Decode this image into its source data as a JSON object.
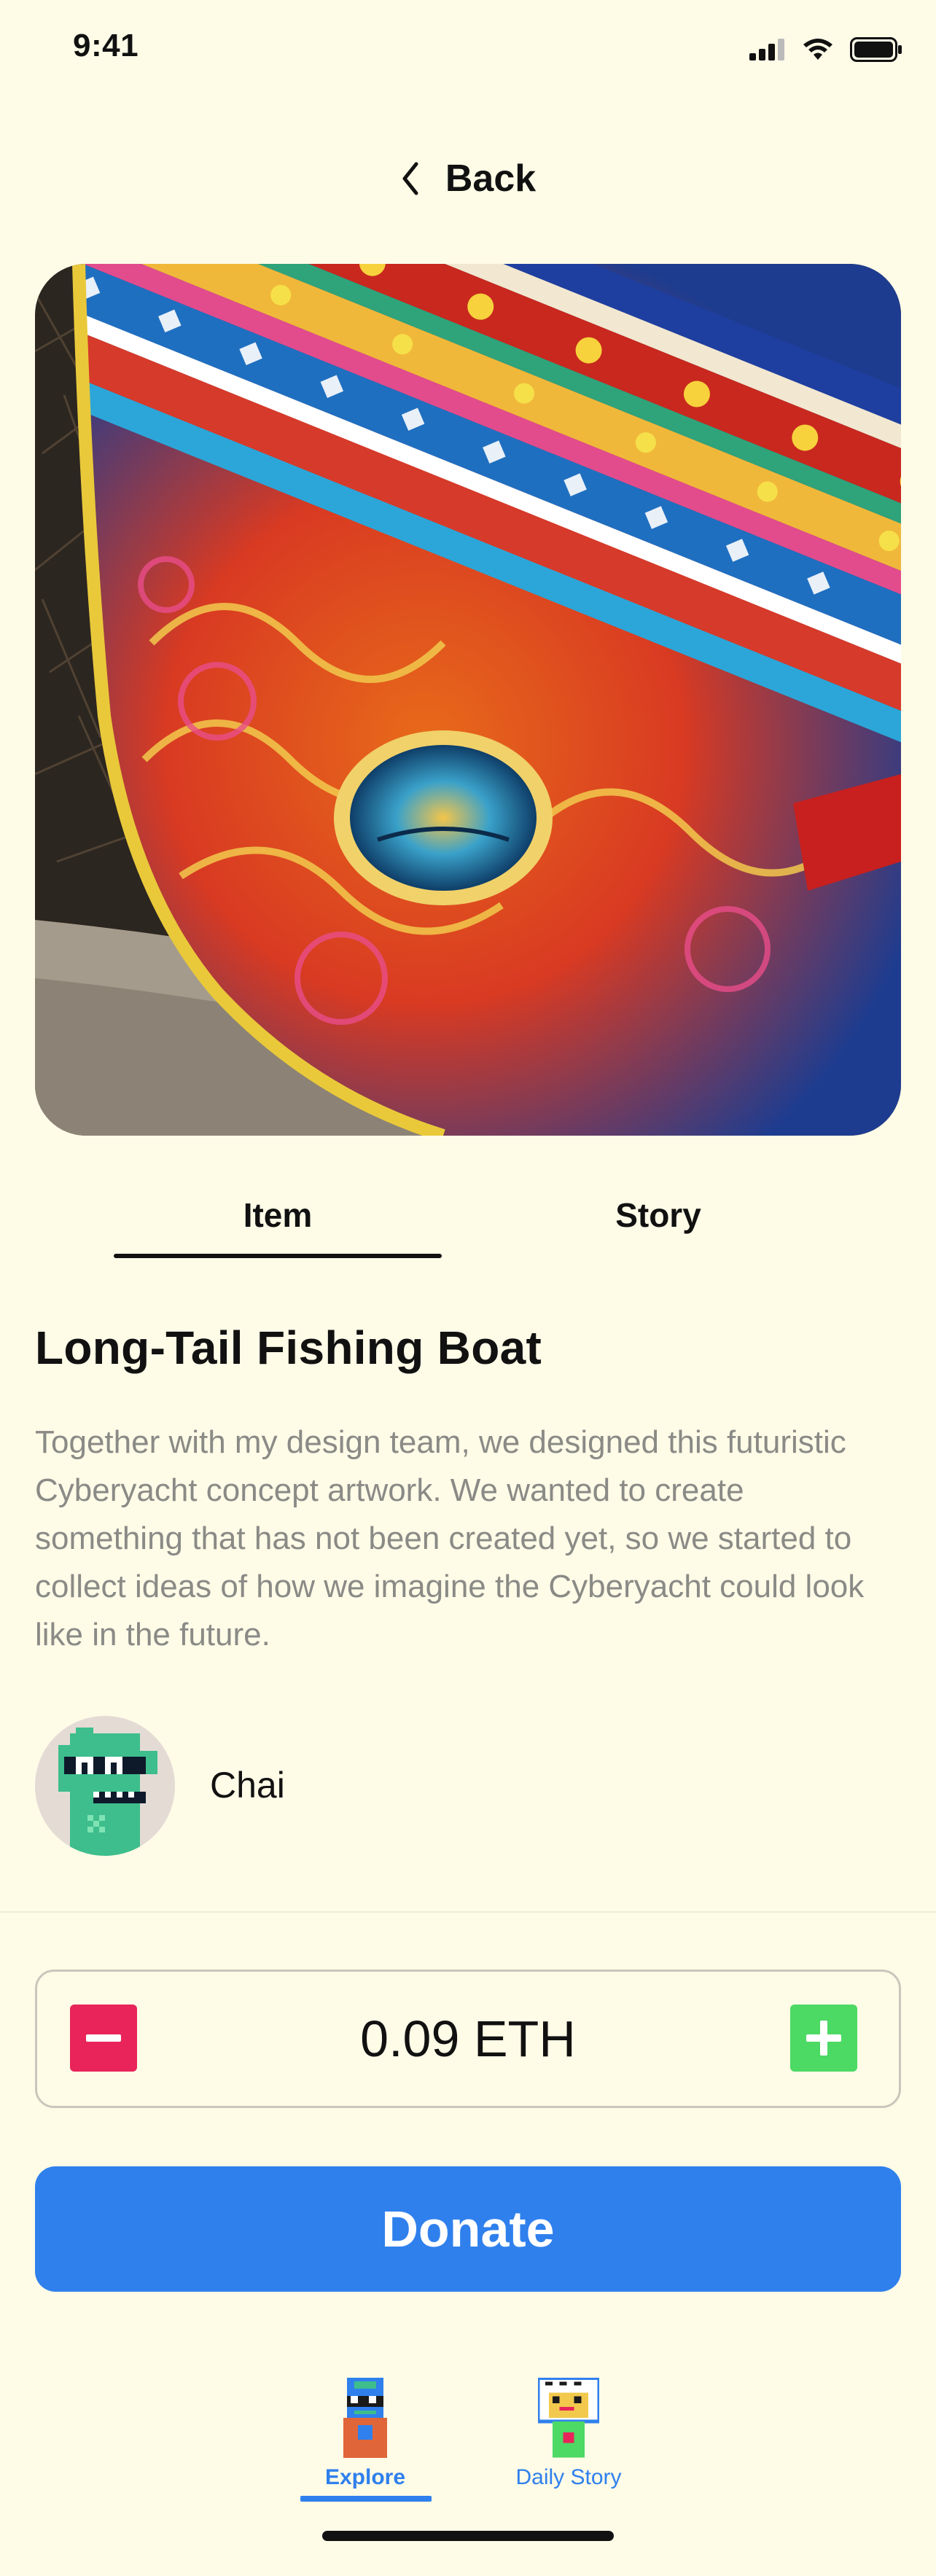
{
  "status_bar": {
    "time": "9:41"
  },
  "header": {
    "back_label": "Back"
  },
  "tabs": [
    {
      "label": "Item",
      "active": true
    },
    {
      "label": "Story",
      "active": false
    }
  ],
  "item": {
    "title": "Long-Tail Fishing Boat",
    "description": "Together with my design team, we designed this futuristic Cyberyacht concept artwork. We wanted to create something that has not been created yet, so we started to collect ideas of how we imagine the Cyberyacht could look like in the future.",
    "owner": {
      "name": "Chai"
    }
  },
  "donation": {
    "amount": "0.09 ETH",
    "button_label": "Donate"
  },
  "bottom_nav": [
    {
      "label": "Explore",
      "active": true,
      "icon": "explore-avatar-icon"
    },
    {
      "label": "Daily Story",
      "active": false,
      "icon": "daily-story-avatar-icon"
    }
  ],
  "colors": {
    "background": "#FEFBE7",
    "accent": "#2F80ED",
    "minus": "#E8245A",
    "plus": "#4CD964",
    "muted_text": "#8A8A86"
  }
}
